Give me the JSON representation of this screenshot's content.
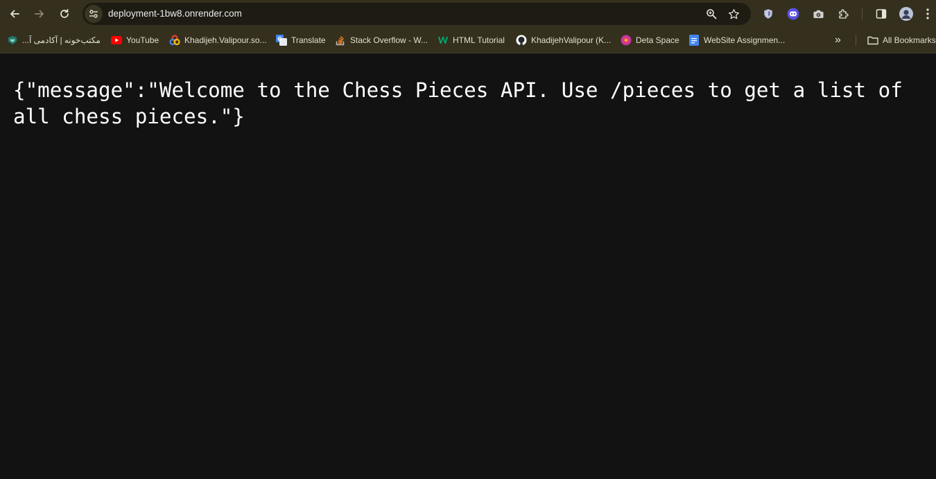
{
  "browser": {
    "url": "deployment-1bw8.onrender.com",
    "icons": {
      "back": "arrow-left-icon",
      "forward": "arrow-right-icon",
      "reload": "reload-icon",
      "site_info": "tune-icon",
      "zoom": "zoom-icon",
      "bookmark": "star-icon",
      "ext1": "shield-icon",
      "ext2": "robot-icon",
      "ext3": "camera-icon",
      "extensions": "puzzle-icon",
      "side_panel": "side-panel-icon",
      "profile": "avatar",
      "menu": "kebab-menu-icon"
    }
  },
  "bookmarks": {
    "items": [
      {
        "label": "مکتب‌خونه | آکادمی آ...",
        "icon": "maktabkhooneh-icon"
      },
      {
        "label": "YouTube",
        "icon": "youtube-icon"
      },
      {
        "label": "Khadijeh.Valipour.so...",
        "icon": "colorful-loop-icon"
      },
      {
        "label": "Translate",
        "icon": "google-translate-icon"
      },
      {
        "label": "Stack Overflow - W...",
        "icon": "stack-overflow-icon"
      },
      {
        "label": "HTML Tutorial",
        "icon": "w3schools-icon"
      },
      {
        "label": "KhadijehValipour (K...",
        "icon": "github-icon"
      },
      {
        "label": "Deta Space",
        "icon": "deta-icon"
      },
      {
        "label": "WebSite Assignmen...",
        "icon": "google-docs-icon"
      }
    ],
    "overflow": "»",
    "all_bookmarks": "All Bookmarks"
  },
  "page": {
    "body_text": "{\"message\":\"Welcome to the Chess Pieces API. Use /pieces to get a list of all chess pieces.\"}"
  },
  "colors": {
    "chrome_bg": "#34301d",
    "omnibox_bg": "#1d1b12",
    "page_bg": "#121212",
    "text": "#ffffff"
  }
}
